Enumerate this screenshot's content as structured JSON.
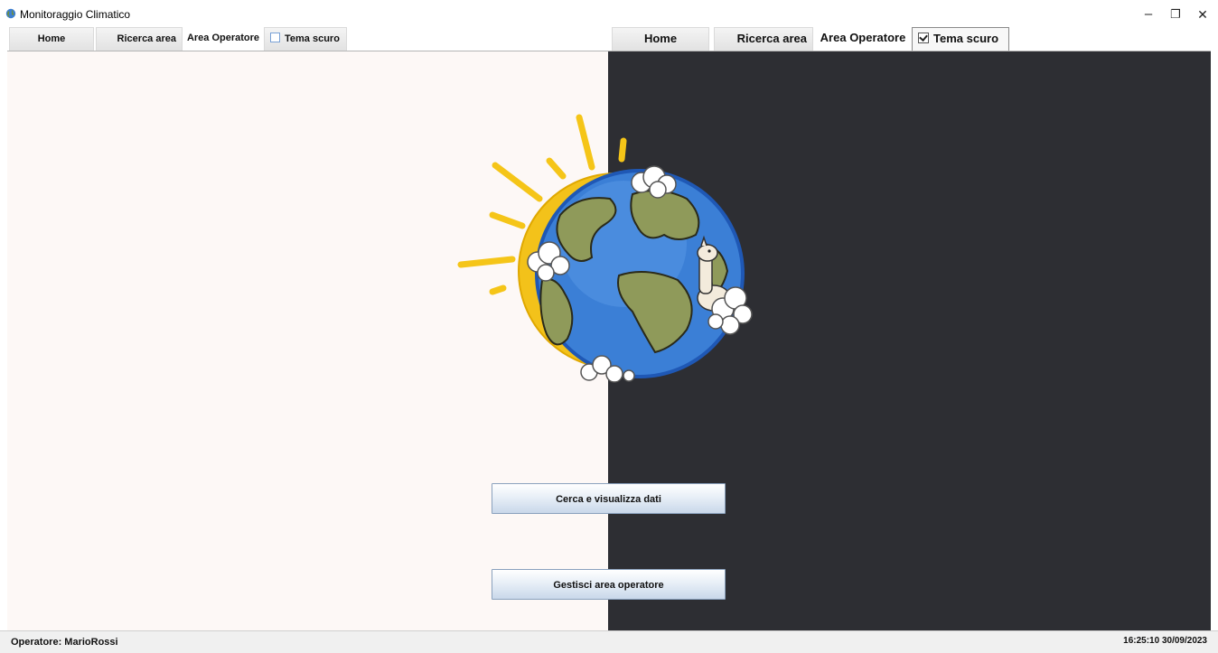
{
  "window": {
    "title": "Monitoraggio Climatico",
    "controls": {
      "minimize": "–",
      "restore": "❐",
      "close": "✕"
    }
  },
  "menu_light": {
    "items": [
      {
        "label": "Home"
      },
      {
        "label": "Ricerca area"
      },
      {
        "label": "Area Operatore"
      },
      {
        "label": "Tema scuro",
        "checked": false
      }
    ]
  },
  "menu_dark": {
    "items": [
      {
        "label": "Home"
      },
      {
        "label": "Ricerca area"
      },
      {
        "label": "Area Operatore"
      },
      {
        "label": "Tema scuro",
        "checked": true
      }
    ]
  },
  "buttons": {
    "search": "Cerca e visualizza dati",
    "operator": "Gestisci area operatore"
  },
  "status": {
    "operator": "Operatore: MarioRossi",
    "datetime": "16:25:10 30/09/2023"
  },
  "colors": {
    "light_bg": "#fdf8f6",
    "dark_bg": "#2d2e33",
    "sun": "#f5c518",
    "ocean": "#2f6fc4",
    "land": "#8f9a5a"
  },
  "icons": [
    "app-globe-icon",
    "checkbox-icon",
    "minimize-icon",
    "restore-icon",
    "close-icon"
  ]
}
